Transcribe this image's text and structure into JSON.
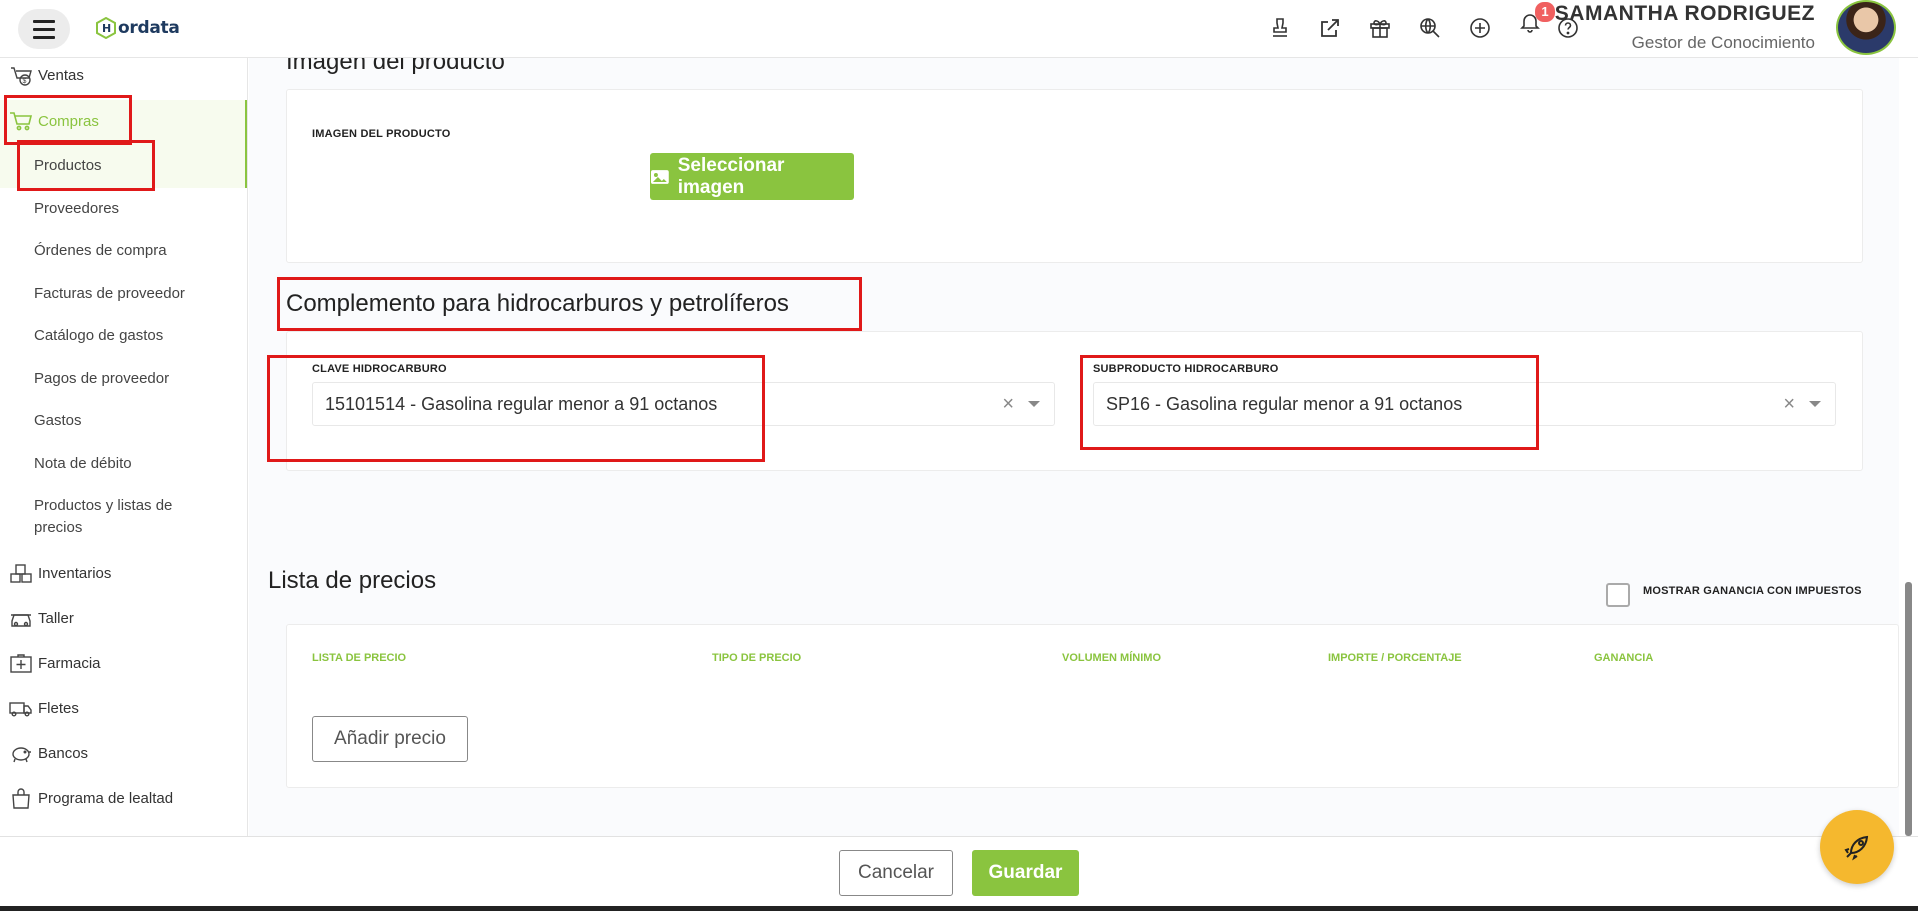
{
  "header": {
    "logo_text": "ordata",
    "user_name": "SAMANTHA RODRIGUEZ",
    "user_role": "Gestor de Conocimiento",
    "notification_count": "1"
  },
  "sidebar": {
    "ventas": "Ventas",
    "compras": "Compras",
    "subitems": [
      "Productos",
      "Proveedores",
      "Órdenes de compra",
      "Facturas de proveedor",
      "Catálogo de gastos",
      "Pagos de proveedor",
      "Gastos",
      "Nota de débito",
      "Productos y listas de",
      "precios"
    ],
    "inventarios": "Inventarios",
    "taller": "Taller",
    "farmacia": "Farmacia",
    "fletes": "Fletes",
    "bancos": "Bancos",
    "lealtad": "Programa de lealtad"
  },
  "image_section": {
    "title": "Imagen del producto",
    "label": "IMAGEN DEL PRODUCTO",
    "button": "Seleccionar imagen"
  },
  "hydrocarbon": {
    "title": "Complemento para hidrocarburos y petrolíferos",
    "clave_label": "CLAVE HIDROCARBURO",
    "clave_value": "15101514 - Gasolina regular menor a 91 octanos",
    "sub_label": "SUBPRODUCTO HIDROCARBURO",
    "sub_value": "SP16 - Gasolina regular menor a 91 octanos",
    "clear_symbol": "×"
  },
  "prices": {
    "title": "Lista de precios",
    "checkbox_label": "MOSTRAR GANANCIA CON IMPUESTOS",
    "columns": [
      "LISTA DE PRECIO",
      "TIPO DE PRECIO",
      "VOLUMEN MÍNIMO",
      "IMPORTE / PORCENTAJE",
      "GANANCIA"
    ],
    "add_button": "Añadir precio"
  },
  "footer": {
    "cancel": "Cancelar",
    "save": "Guardar"
  },
  "colors": {
    "accent": "#8ac43f",
    "highlight": "#e01919",
    "fab": "#f5b82e"
  }
}
